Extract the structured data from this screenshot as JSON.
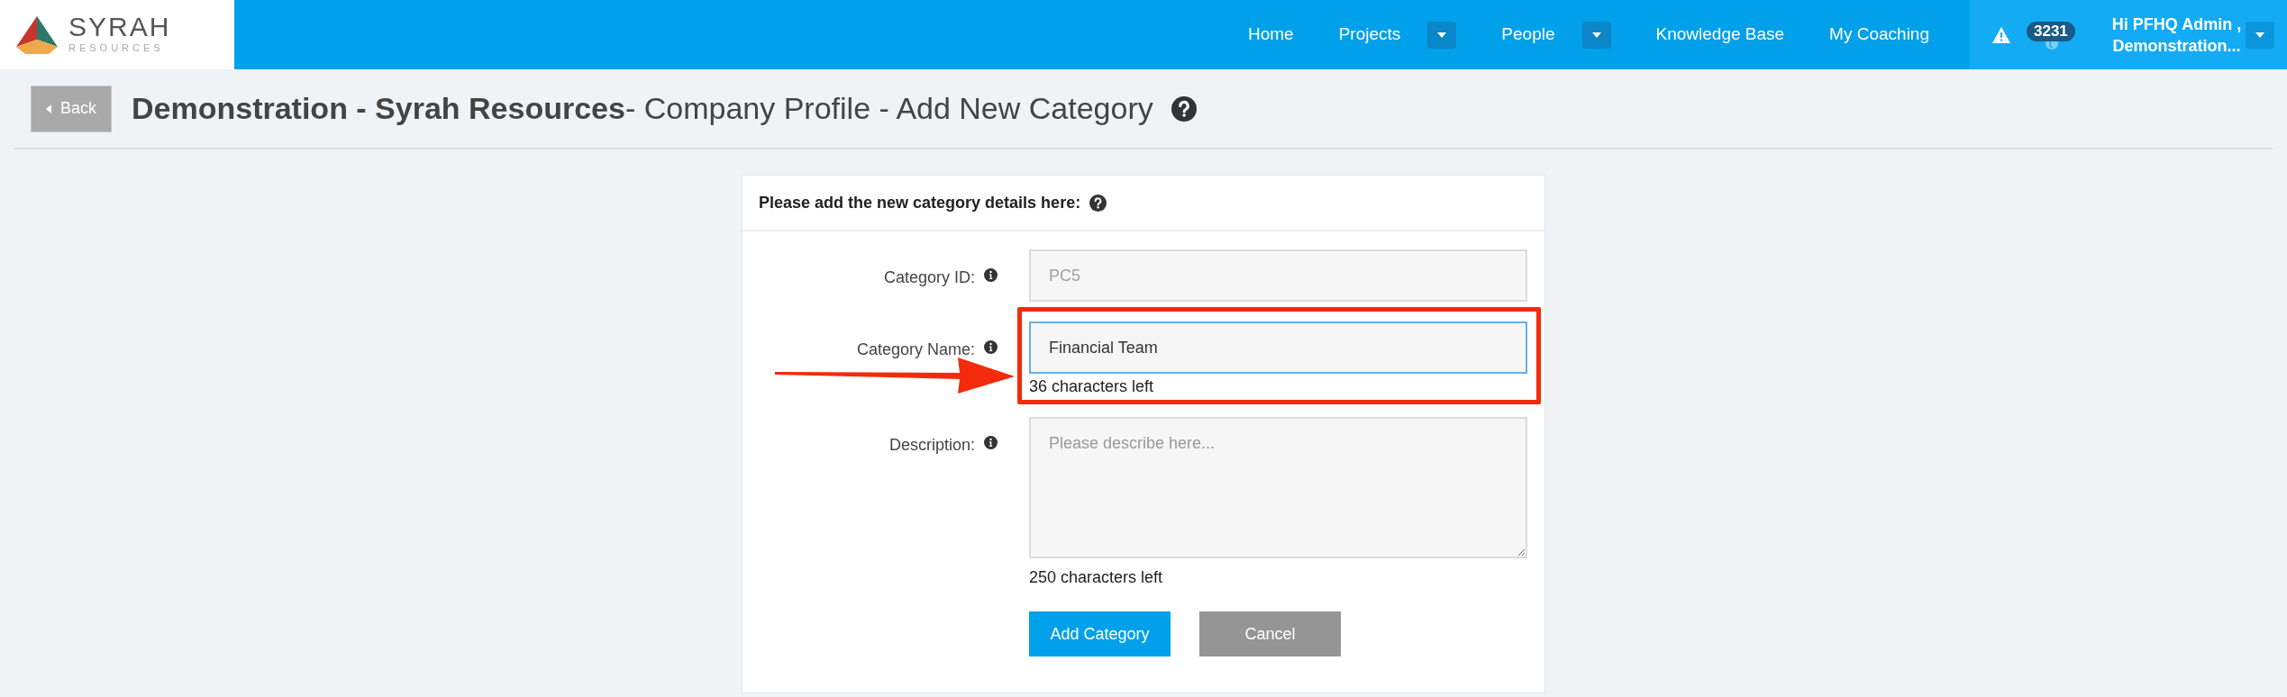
{
  "header": {
    "logo": {
      "name": "SYRAH",
      "tagline": "RESOURCES"
    },
    "nav": [
      {
        "label": "Home",
        "dropdown": false
      },
      {
        "label": "Projects",
        "dropdown": true
      },
      {
        "label": "People",
        "dropdown": true
      },
      {
        "label": "Knowledge Base",
        "dropdown": false
      },
      {
        "label": "My Coaching",
        "dropdown": false
      }
    ],
    "alerts": {
      "count": "3231"
    },
    "user": {
      "greeting": "Hi PFHQ Admin ,",
      "org": "Demonstration..."
    }
  },
  "page": {
    "back": "Back",
    "title": "**Demonstration - Syrah Resources**- Company Profile - Add New Category"
  },
  "form": {
    "heading": "Please add the new category details here:",
    "fields": [
      {
        "kind": "input",
        "label": "Category ID:",
        "value": "PC5",
        "disabled": true,
        "focused": false,
        "highlighted": false
      },
      {
        "kind": "input",
        "label": "Category Name:",
        "value": "Financial Team",
        "disabled": false,
        "focused": true,
        "highlighted": true,
        "counter": "36 characters left"
      },
      {
        "kind": "textarea",
        "label": "Description:",
        "placeholder": "Please describe here...",
        "disabled": false,
        "focused": false,
        "highlighted": false,
        "counter": "250 characters left"
      }
    ],
    "buttons": [
      {
        "label": "Add Category",
        "kind": "primary"
      },
      {
        "label": "Cancel",
        "kind": "secondary"
      }
    ]
  }
}
